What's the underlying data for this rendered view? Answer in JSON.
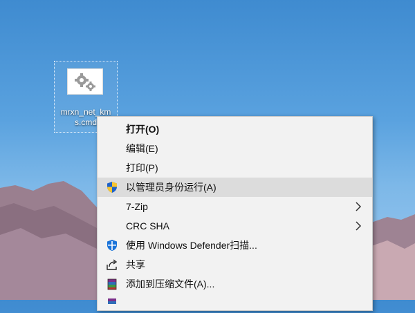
{
  "desktop": {
    "file": {
      "label": "mrxn_net_kms.cmd",
      "icon": "gear-file-icon"
    }
  },
  "context_menu": {
    "items": [
      {
        "label": "打开(O)",
        "bold": true,
        "icon": "",
        "submenu": false
      },
      {
        "label": "编辑(E)",
        "bold": false,
        "icon": "",
        "submenu": false
      },
      {
        "label": "打印(P)",
        "bold": false,
        "icon": "",
        "submenu": false
      },
      {
        "label": "以管理员身份运行(A)",
        "bold": false,
        "icon": "uac-shield-icon",
        "submenu": false,
        "highlighted": true
      },
      {
        "label": "7-Zip",
        "bold": false,
        "icon": "",
        "submenu": true
      },
      {
        "label": "CRC SHA",
        "bold": false,
        "icon": "",
        "submenu": true
      },
      {
        "label": "使用 Windows Defender扫描...",
        "bold": false,
        "icon": "windows-defender-icon",
        "submenu": false
      },
      {
        "label": "共享",
        "bold": false,
        "icon": "share-icon",
        "submenu": false
      },
      {
        "label": "添加到压缩文件(A)...",
        "bold": false,
        "icon": "winrar-icon",
        "submenu": false
      }
    ]
  }
}
